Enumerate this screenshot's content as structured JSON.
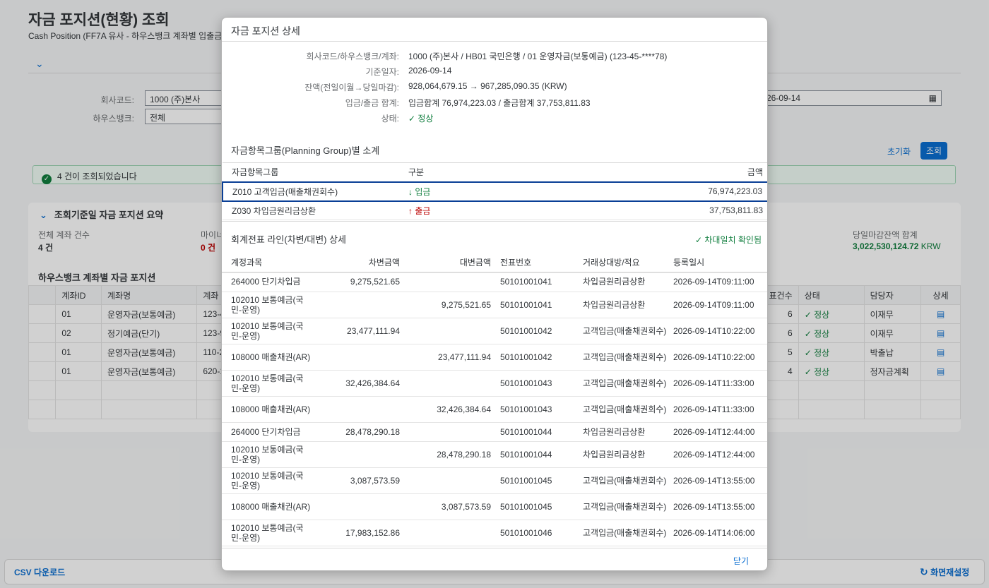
{
  "page": {
    "title": "자금 포지션(현황) 조회",
    "subtitle": "Cash Position (FF7A 유사 - 하우스뱅크 계좌별 입출금"
  },
  "filters": {
    "company_label": "회사코드:",
    "company_value": "1000 (주)본사",
    "housebank_label": "하우스뱅크:",
    "housebank_value": "전체",
    "date_value": "26-09-14",
    "reset_label": "초기화",
    "go_label": "조회"
  },
  "message": "4 건이 조회되었습니다",
  "summary": {
    "title": "조회기준일 자금 포지션 요약",
    "total_label": "전체 계좌 건수",
    "total_value": "4 건",
    "minus_label": "마이너",
    "minus_value": "0 건",
    "closing_label": "당일마감잔액 합계",
    "closing_value": "3,022,530,124.72",
    "closing_unit": "KRW"
  },
  "accounts": {
    "title": "하우스뱅크 계좌별 자금 포지션",
    "headers": [
      "계좌ID",
      "계좌명",
      "계좌",
      "표건수",
      "상태",
      "담당자",
      "상세"
    ],
    "rows": [
      {
        "id": "01",
        "name": "운영자금(보통예금)",
        "acct": "123-4",
        "cnt": "6",
        "status": "정상",
        "owner": "이재무"
      },
      {
        "id": "02",
        "name": "정기예금(단기)",
        "acct": "123-9",
        "cnt": "6",
        "status": "정상",
        "owner": "이재무"
      },
      {
        "id": "01",
        "name": "운영자금(보통예금)",
        "acct": "110-2",
        "cnt": "5",
        "status": "정상",
        "owner": "박출납"
      },
      {
        "id": "01",
        "name": "운영자금(보통예금)",
        "acct": "620-1",
        "cnt": "4",
        "status": "정상",
        "owner": "정자금계획"
      }
    ]
  },
  "footer": {
    "csv_label": "CSV 다운로드",
    "reset_label": "화면재설정"
  },
  "dialog": {
    "title": "자금 포지션 상세",
    "info": [
      {
        "label": "회사코드/하우스뱅크/계좌:",
        "value": "1000 (주)본사 / HB01 국민은행 / 01 운영자금(보통예금) (123-45-****78)"
      },
      {
        "label": "기준일자:",
        "value": "2026-09-14"
      },
      {
        "label": "잔액(전일이월→당일마감):",
        "value": "928,064,679.15 → 967,285,090.35 (KRW)"
      },
      {
        "label": "입금/출금 합계:",
        "value": "입금합계 76,974,223.03 / 출금합계 37,753,811.83"
      },
      {
        "label": "상태:",
        "value": "정상"
      }
    ],
    "group_title": "자금항목그룹(Planning Group)별 소계",
    "group_headers": {
      "group": "자금항목그룹",
      "type": "구분",
      "amount": "금액"
    },
    "groups": [
      {
        "group": "Z010 고객입금(매출채권회수)",
        "type": "입금",
        "amount": "76,974,223.03"
      },
      {
        "group": "Z030 차입금원리금상환",
        "type": "출금",
        "amount": "37,753,811.83"
      }
    ],
    "lines_title": "회계전표 라인(차변/대변) 상세",
    "balanced_label": "차대일치 확인됨",
    "line_headers": {
      "account": "계정과목",
      "debit": "차변금액",
      "credit": "대변금액",
      "doc": "전표번호",
      "partner": "거래상대방/적요",
      "created": "등록일시"
    },
    "lines": [
      {
        "account": "264000 단기차입금",
        "debit": "9,275,521.65",
        "credit": "",
        "doc": "50101001041",
        "partner": "차입금원리금상환",
        "created": "2026-09-14T09:11:00"
      },
      {
        "account": "102010 보통예금(국민-운영)",
        "debit": "",
        "credit": "9,275,521.65",
        "doc": "50101001041",
        "partner": "차입금원리금상환",
        "created": "2026-09-14T09:11:00"
      },
      {
        "account": "102010 보통예금(국민-운영)",
        "debit": "23,477,111.94",
        "credit": "",
        "doc": "50101001042",
        "partner": "고객입금(매출채권회수)",
        "created": "2026-09-14T10:22:00"
      },
      {
        "account": "108000 매출채권(AR)",
        "debit": "",
        "credit": "23,477,111.94",
        "doc": "50101001042",
        "partner": "고객입금(매출채권회수)",
        "created": "2026-09-14T10:22:00"
      },
      {
        "account": "102010 보통예금(국민-운영)",
        "debit": "32,426,384.64",
        "credit": "",
        "doc": "50101001043",
        "partner": "고객입금(매출채권회수)",
        "created": "2026-09-14T11:33:00"
      },
      {
        "account": "108000 매출채권(AR)",
        "debit": "",
        "credit": "32,426,384.64",
        "doc": "50101001043",
        "partner": "고객입금(매출채권회수)",
        "created": "2026-09-14T11:33:00"
      },
      {
        "account": "264000 단기차입금",
        "debit": "28,478,290.18",
        "credit": "",
        "doc": "50101001044",
        "partner": "차입금원리금상환",
        "created": "2026-09-14T12:44:00"
      },
      {
        "account": "102010 보통예금(국민-운영)",
        "debit": "",
        "credit": "28,478,290.18",
        "doc": "50101001044",
        "partner": "차입금원리금상환",
        "created": "2026-09-14T12:44:00"
      },
      {
        "account": "102010 보통예금(국민-운영)",
        "debit": "3,087,573.59",
        "credit": "",
        "doc": "50101001045",
        "partner": "고객입금(매출채권회수)",
        "created": "2026-09-14T13:55:00"
      },
      {
        "account": "108000 매출채권(AR)",
        "debit": "",
        "credit": "3,087,573.59",
        "doc": "50101001045",
        "partner": "고객입금(매출채권회수)",
        "created": "2026-09-14T13:55:00"
      },
      {
        "account": "102010 보통예금(국민-운영)",
        "debit": "17,983,152.86",
        "credit": "",
        "doc": "50101001046",
        "partner": "고객입금(매출채권회수)",
        "created": "2026-09-14T14:06:00"
      }
    ],
    "close_label": "닫기"
  }
}
